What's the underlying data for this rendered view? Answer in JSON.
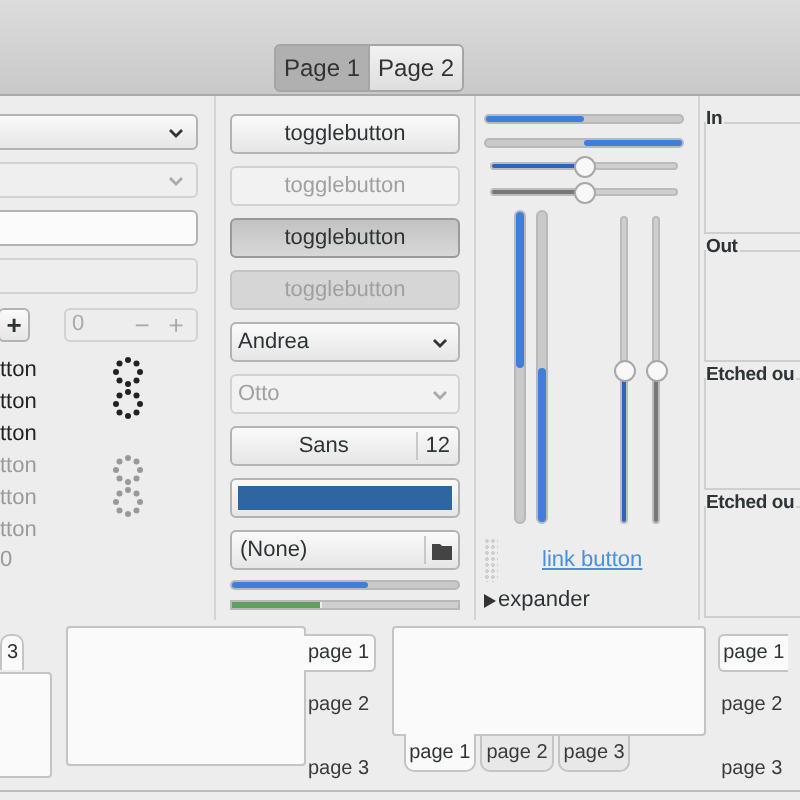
{
  "header": {
    "stack_switcher": [
      {
        "label": "Page 1",
        "selected": true
      },
      {
        "label": "Page 2",
        "selected": false
      }
    ]
  },
  "column_1": {
    "combos": [
      {
        "disabled": false
      },
      {
        "disabled": true
      }
    ],
    "entries": [
      {
        "disabled": false
      },
      {
        "disabled": true
      }
    ],
    "spin_button_cut": {
      "plus": "+"
    },
    "spin_button": {
      "value": "0",
      "minus": "−",
      "plus": "+",
      "disabled": true
    },
    "buttons": [
      {
        "label": "tton",
        "disabled": false
      },
      {
        "label": "tton",
        "disabled": false
      },
      {
        "label": "tton",
        "disabled": false
      },
      {
        "label": "tton",
        "disabled": true
      },
      {
        "label": "tton",
        "disabled": true
      },
      {
        "label": "tton",
        "disabled": true
      }
    ],
    "cut_text": "0",
    "spinners": [
      {
        "disabled": false
      },
      {
        "disabled": true
      }
    ]
  },
  "column_2": {
    "toggle_buttons": [
      {
        "label": "togglebutton",
        "selected": false,
        "disabled": false
      },
      {
        "label": "togglebutton",
        "selected": false,
        "disabled": true
      },
      {
        "label": "togglebutton",
        "selected": true,
        "disabled": false
      },
      {
        "label": "togglebutton",
        "selected": true,
        "disabled": true
      }
    ],
    "combos": [
      {
        "value": "Andrea",
        "disabled": false
      },
      {
        "value": "Otto",
        "disabled": true
      }
    ],
    "font_button": {
      "font": "Sans",
      "size": "12"
    },
    "color_button": {
      "color": "#2f65a0"
    },
    "file_button": {
      "label": "(None)"
    },
    "progress_bar": {
      "level": 0.6
    },
    "level_bar": {
      "level": 0.4
    }
  },
  "column_3": {
    "progress_bars": [
      {
        "level": 0.5,
        "inverted": false
      },
      {
        "level": 0.5,
        "inverted": true
      }
    ],
    "scales": [
      {
        "level": 0.5,
        "disabled": false
      },
      {
        "level": 0.5,
        "disabled": true
      }
    ],
    "vertical_progress_bars": [
      {
        "level": 0.5,
        "inverted": true
      },
      {
        "level": 0.5,
        "inverted": false
      }
    ],
    "vertical_scales": [
      {
        "level": 0.5,
        "disabled": false
      },
      {
        "level": 0.5,
        "disabled": true
      }
    ],
    "link": "link button",
    "expander": {
      "label": "expander",
      "expanded": false
    }
  },
  "frames": [
    {
      "label": "In"
    },
    {
      "label": "Out"
    },
    {
      "label": "Etched ou"
    },
    {
      "label": "Etched ou"
    }
  ],
  "notebooks": [
    {
      "kind": "top",
      "tabs": [
        {
          "label": "3",
          "selected": true
        }
      ]
    },
    {
      "kind": "right",
      "tabs": [
        {
          "label": "page 1",
          "selected": true
        },
        {
          "label": "page 2",
          "selected": false
        },
        {
          "label": "page 3",
          "selected": false
        }
      ]
    },
    {
      "kind": "bottom",
      "tabs": [
        {
          "label": "page 1",
          "selected": true
        },
        {
          "label": "page 2",
          "selected": false
        },
        {
          "label": "page 3",
          "selected": false
        }
      ]
    },
    {
      "kind": "left",
      "tabs": [
        {
          "label": "page 1",
          "selected": true
        },
        {
          "label": "page 2",
          "selected": false
        },
        {
          "label": "page 3",
          "selected": false
        }
      ]
    }
  ]
}
